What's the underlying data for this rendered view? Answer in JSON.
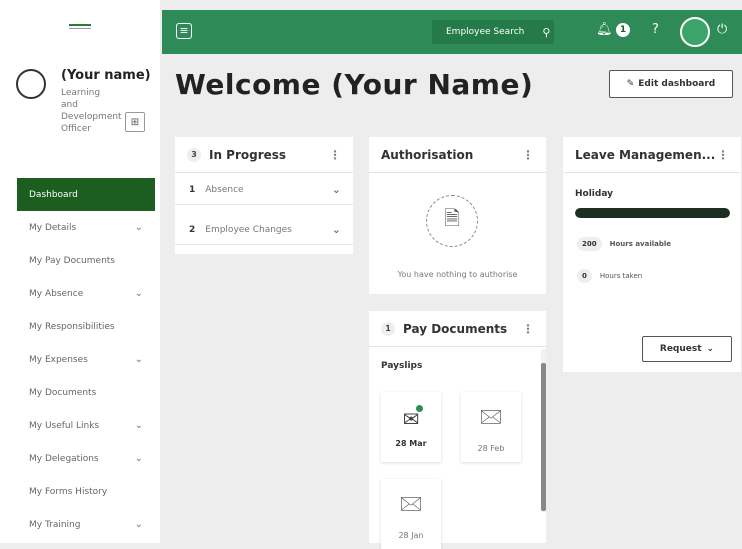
{
  "sidebar": {
    "profile": {
      "name": "(Your name)",
      "job_title": "Learning and Development Officer"
    },
    "items": [
      {
        "label": "Dashboard",
        "active": true,
        "expandable": false
      },
      {
        "label": "My Details",
        "active": false,
        "expandable": true
      },
      {
        "label": "My Pay Documents",
        "active": false,
        "expandable": false
      },
      {
        "label": "My Absence",
        "active": false,
        "expandable": true
      },
      {
        "label": "My Responsibilities",
        "active": false,
        "expandable": false
      },
      {
        "label": "My Expenses",
        "active": false,
        "expandable": true
      },
      {
        "label": "My Documents",
        "active": false,
        "expandable": false
      },
      {
        "label": "My Useful Links",
        "active": false,
        "expandable": true
      },
      {
        "label": "My Delegations",
        "active": false,
        "expandable": true
      },
      {
        "label": "My Forms History",
        "active": false,
        "expandable": false
      },
      {
        "label": "My Training",
        "active": false,
        "expandable": true
      }
    ]
  },
  "topbar": {
    "search_label": "Employee Search",
    "notification_count": "1",
    "accent": "#2e8b57"
  },
  "main": {
    "welcome": "Welcome  (Your Name)",
    "edit_dashboard": "Edit dashboard"
  },
  "cards": {
    "in_progress": {
      "count": "3",
      "title": "In Progress",
      "rows": [
        {
          "count": "1",
          "label": "Absence"
        },
        {
          "count": "2",
          "label": "Employee Changes"
        }
      ]
    },
    "authorisation": {
      "title": "Authorisation",
      "empty_message": "You have nothing to authorise"
    },
    "leave": {
      "title": "Leave Managemen...",
      "section": "Holiday",
      "hours_available": "200",
      "hours_available_label": "Hours available",
      "hours_taken": "0",
      "hours_taken_label": "Hours taken",
      "used_fraction": 0.0,
      "request_label": "Request"
    },
    "pay_documents": {
      "count": "1",
      "title": "Pay Documents",
      "section": "Payslips",
      "slips": [
        {
          "date": "28 Mar",
          "unread": true
        },
        {
          "date": "28 Feb",
          "unread": false
        },
        {
          "date": "28 Jan",
          "unread": false
        }
      ]
    }
  },
  "colors": {
    "brand_green": "#2e8b57",
    "nav_active": "#1b5e20",
    "bar_dark": "#1a2e22"
  }
}
